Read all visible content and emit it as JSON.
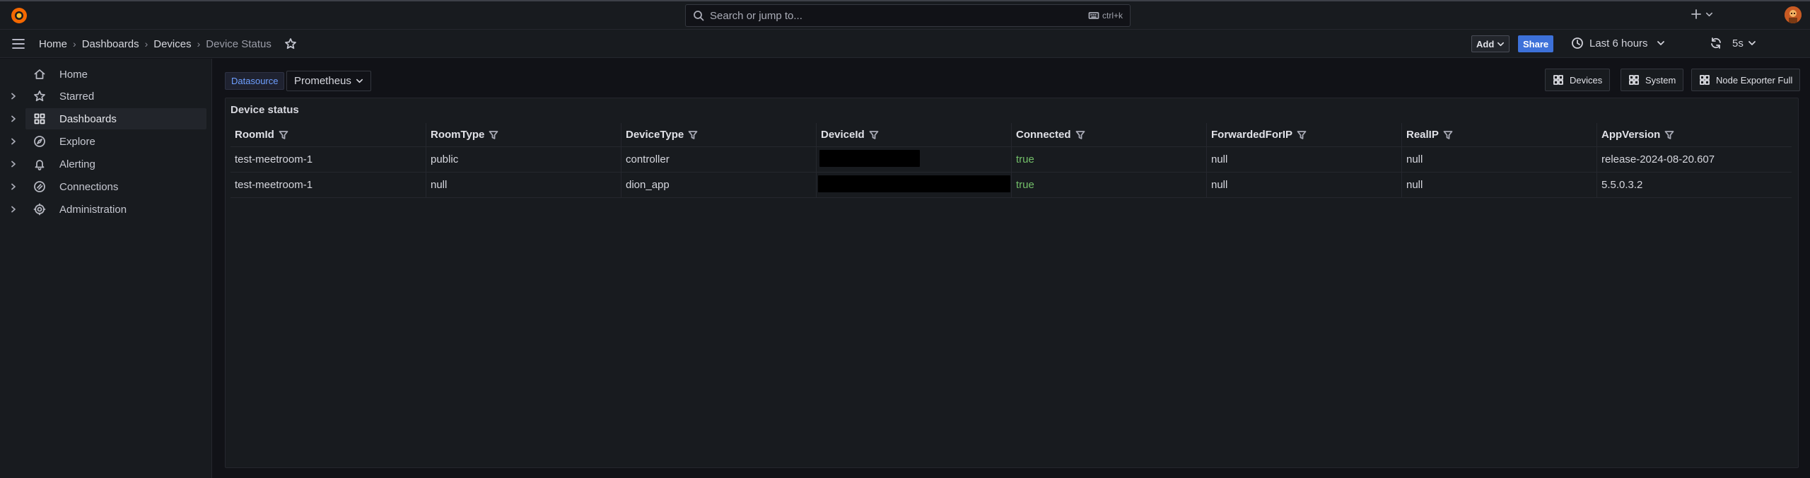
{
  "search": {
    "placeholder": "Search or jump to...",
    "shortcut": "ctrl+k"
  },
  "breadcrumb": [
    "Home",
    "Dashboards",
    "Devices",
    "Device Status"
  ],
  "toolbar": {
    "add_label": "Add",
    "share_label": "Share",
    "time_range": "Last 6 hours",
    "refresh_interval": "5s"
  },
  "sidebar": {
    "items": [
      {
        "label": "Home",
        "icon": "home-icon",
        "expandable": false,
        "active": false
      },
      {
        "label": "Starred",
        "icon": "star-icon",
        "expandable": true,
        "active": false
      },
      {
        "label": "Dashboards",
        "icon": "apps-icon",
        "expandable": true,
        "active": true
      },
      {
        "label": "Explore",
        "icon": "compass-icon",
        "expandable": true,
        "active": false
      },
      {
        "label": "Alerting",
        "icon": "bell-icon",
        "expandable": true,
        "active": false
      },
      {
        "label": "Connections",
        "icon": "link-icon",
        "expandable": true,
        "active": false
      },
      {
        "label": "Administration",
        "icon": "cog-icon",
        "expandable": true,
        "active": false
      }
    ]
  },
  "variables": {
    "label": "Datasource",
    "value": "Prometheus"
  },
  "dashboard_links": [
    "Devices",
    "System",
    "Node Exporter Full"
  ],
  "panel": {
    "title": "Device status",
    "columns": [
      "RoomId",
      "RoomType",
      "DeviceType",
      "DeviceId",
      "Connected",
      "ForwardedForIP",
      "RealIP",
      "AppVersion"
    ],
    "rows": [
      [
        "test-meetroom-1",
        "public",
        "controller",
        "",
        "true",
        "null",
        "null",
        "release-2024-08-20.607"
      ],
      [
        "test-meetroom-1",
        "null",
        "dion_app",
        "",
        "true",
        "null",
        "null",
        "5.5.0.3.2"
      ]
    ]
  },
  "colors": {
    "accent": "#f26b2e",
    "primary": "#3d71d9",
    "success": "#73bf69",
    "link": "#6e9fff"
  }
}
